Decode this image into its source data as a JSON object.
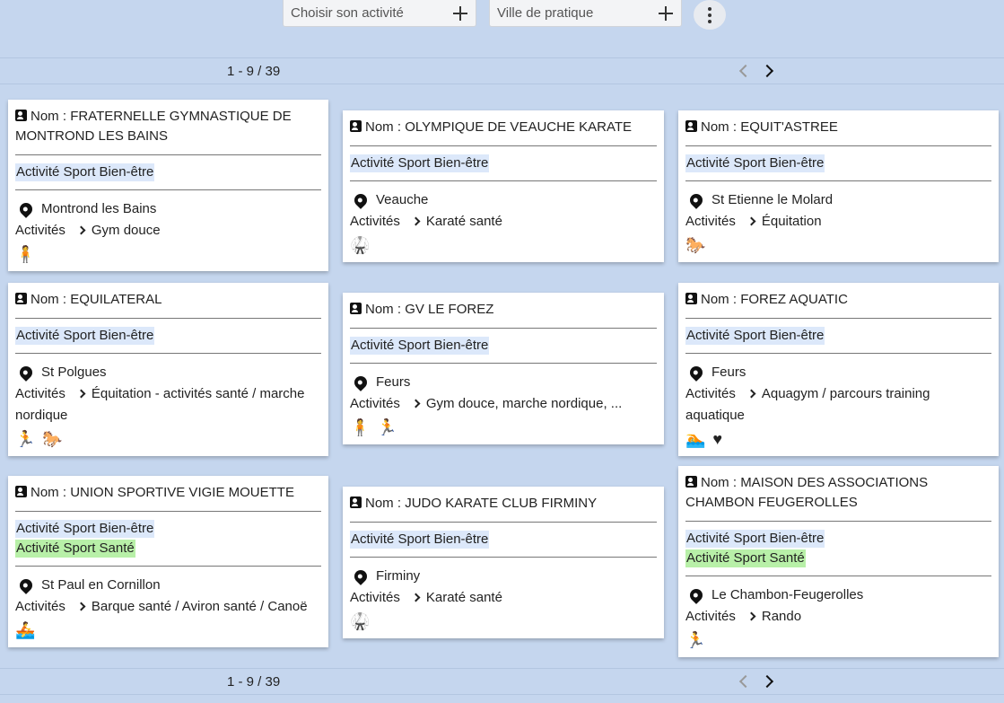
{
  "filters": {
    "activity_placeholder": "Choisir son activité",
    "city_placeholder": "Ville de pratique"
  },
  "pager": {
    "count": "1 - 9 / 39"
  },
  "labels": {
    "name_prefix": "Nom : ",
    "activities": "Activités"
  },
  "cards": [
    {
      "name": "FRATERNELLE GYMNASTIQUE DE MONTROND LES BAINS",
      "tags": [
        "Activité Sport Bien-être"
      ],
      "city": "Montrond les Bains",
      "activity": "Gym douce",
      "icons": [
        "gym-icon"
      ]
    },
    {
      "name": "OLYMPIQUE DE VEAUCHE KARATE",
      "tags": [
        "Activité Sport Bien-être"
      ],
      "city": "Veauche",
      "activity": "Karaté santé",
      "icons": [
        "martial-arts-icon"
      ]
    },
    {
      "name": "EQUIT'ASTREE",
      "tags": [
        "Activité Sport Bien-être"
      ],
      "city": "St Etienne le Molard",
      "activity": "Équitation",
      "icons": [
        "horse-icon"
      ]
    },
    {
      "name": "EQUILATERAL",
      "tags": [
        "Activité Sport Bien-être"
      ],
      "city": "St Polgues",
      "activity": "Équitation - activités santé / marche nordique",
      "icons": [
        "walking-icon",
        "horse-icon"
      ]
    },
    {
      "name": "GV LE FOREZ",
      "tags": [
        "Activité Sport Bien-être"
      ],
      "city": "Feurs",
      "activity": "Gym douce, marche nordique, ...",
      "icons": [
        "gym-icon",
        "walking-icon"
      ]
    },
    {
      "name": "FOREZ AQUATIC",
      "tags": [
        "Activité Sport Bien-être"
      ],
      "city": "Feurs",
      "activity": "Aquagym / parcours training aquatique",
      "icons": [
        "swimming-icon",
        "heart-icon"
      ]
    },
    {
      "name": "UNION SPORTIVE VIGIE MOUETTE",
      "tags": [
        "Activité Sport Bien-être",
        "Activité Sport Santé"
      ],
      "city": "St Paul en Cornillon",
      "activity": "Barque santé / Aviron santé / Canoë",
      "icons": [
        "rowing-icon"
      ]
    },
    {
      "name": "JUDO KARATE CLUB FIRMINY",
      "tags": [
        "Activité Sport Bien-être"
      ],
      "city": "Firminy",
      "activity": "Karaté santé",
      "icons": [
        "martial-arts-icon"
      ]
    },
    {
      "name": "MAISON DES ASSOCIATIONS CHAMBON FEUGEROLLES",
      "tags": [
        "Activité Sport Bien-être",
        "Activité Sport Santé"
      ],
      "city": "Le Chambon-Feugerolles",
      "activity": "Rando",
      "icons": [
        "walking-icon"
      ]
    }
  ]
}
